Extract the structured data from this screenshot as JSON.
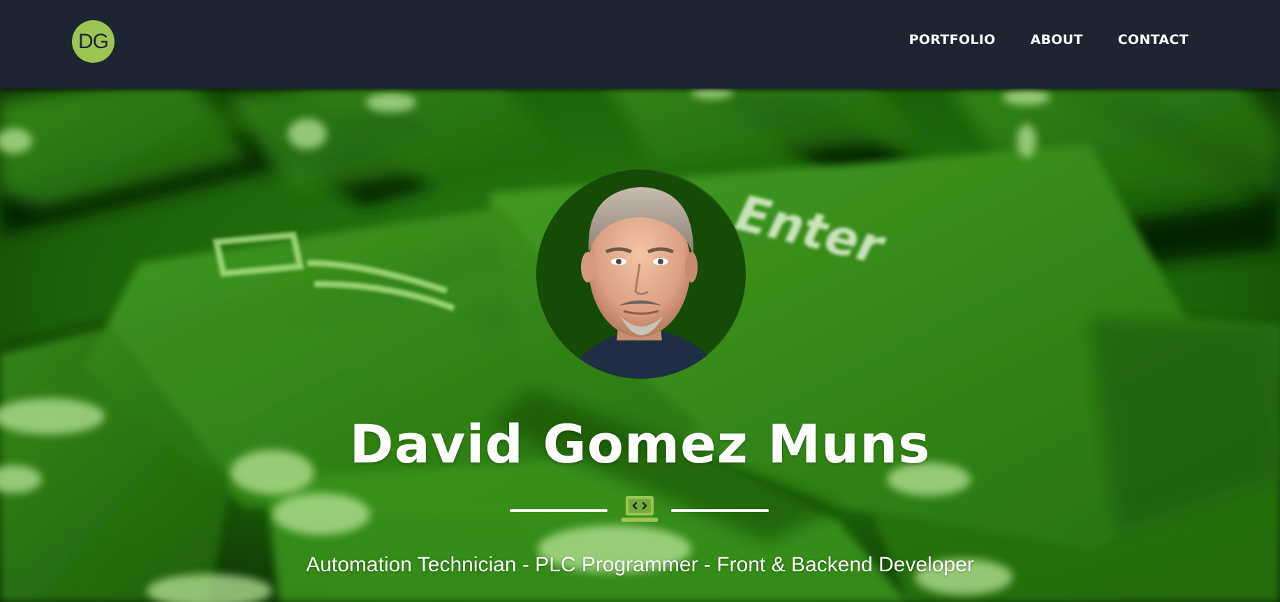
{
  "navbar": {
    "logo_text": "DG",
    "links": [
      "PORTFOLIO",
      "ABOUT",
      "CONTACT"
    ]
  },
  "hero": {
    "name": "David Gomez Muns",
    "subtitle": "Automation Technician - PLC Programmer - Front & Backend Developer",
    "background_photo_key_label": "Enter",
    "divider_icon": "laptop-code-icon",
    "accent_color": "#9cc553"
  },
  "colors": {
    "navbar_bg": "#1c2531",
    "accent": "#9cc553",
    "text": "#ffffff"
  }
}
